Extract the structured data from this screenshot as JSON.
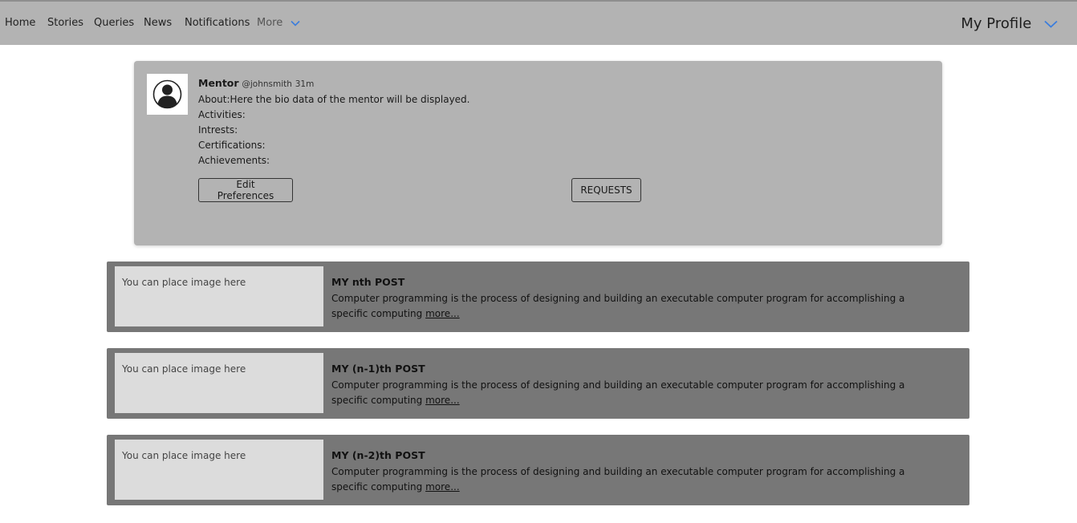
{
  "nav": {
    "items": [
      "Home",
      "Stories",
      "Queries",
      "News",
      "Notifications"
    ],
    "more_label": "More",
    "profile_label": "My Profile"
  },
  "profile_card": {
    "role": "Mentor",
    "handle": "@johnsmith",
    "time": "31m",
    "about": "About:Here the bio data of the mentor will be displayed.",
    "activities": "Activities:",
    "interests": "Intrests:",
    "certifications": "Certifications:",
    "achievements": "Achievements:",
    "edit_button": "Edit Preferences",
    "requests_button": "REQUESTS"
  },
  "posts": [
    {
      "image_placeholder": "You can place image here",
      "title": "MY nth POST",
      "body": "Computer programming is the process of designing and building an executable computer program for accomplishing a specific computing",
      "more": "more..."
    },
    {
      "image_placeholder": "You can place image here",
      "title": "MY (n-1)th POST",
      "body": "Computer programming is the process of designing and building an executable computer program for accomplishing a specific computing",
      "more": "more..."
    },
    {
      "image_placeholder": "You can place image here",
      "title": "MY (n-2)th POST",
      "body": "Computer programming is the process of designing and building an executable computer program for accomplishing a specific computing",
      "more": "more..."
    }
  ],
  "colors": {
    "navbar": "#b3b3b3",
    "card": "#b3b3b3",
    "post": "#777777",
    "image_placeholder": "#dcdcdc",
    "chevron": "#3b7ddd"
  }
}
